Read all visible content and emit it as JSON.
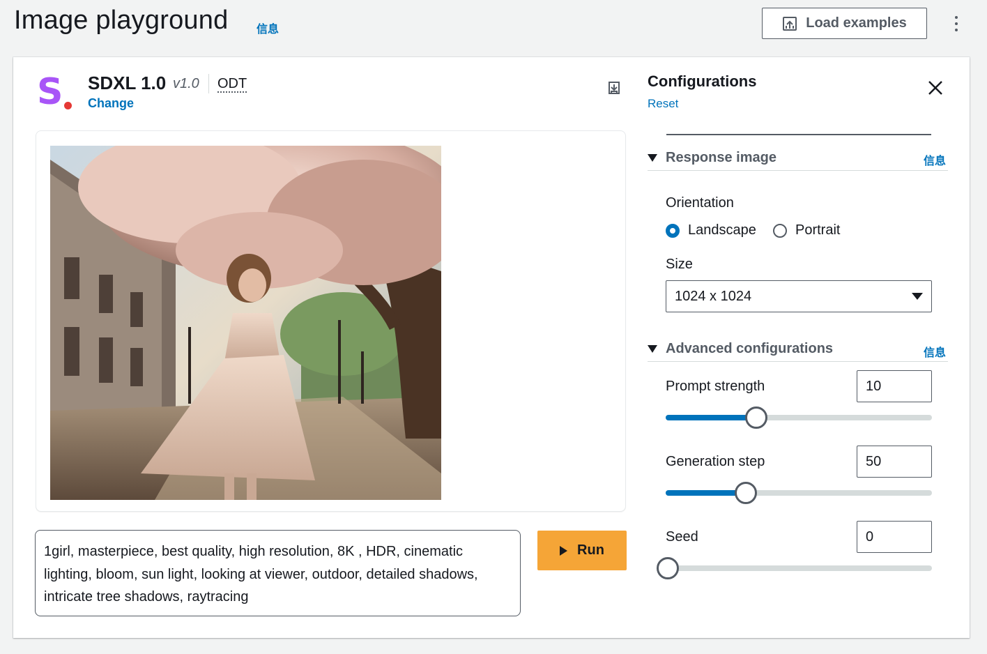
{
  "header": {
    "title": "Image playground",
    "info": "信息",
    "load_examples": "Load examples"
  },
  "model": {
    "name": "SDXL 1.0",
    "version": "v1.0",
    "odt": "ODT",
    "change": "Change",
    "logo_letter": "S",
    "logo_color": "#a855f7",
    "logo_dot_color": "#e53935"
  },
  "prompt": {
    "text": "1girl, masterpiece, best quality, high resolution, 8K , HDR, cinematic lighting, bloom, sun light, looking at viewer, outdoor, detailed shadows, intricate tree shadows, raytracing"
  },
  "run_label": "Run",
  "config": {
    "title": "Configurations",
    "reset": "Reset",
    "response_image": {
      "title": "Response image",
      "info": "信息",
      "orientation_label": "Orientation",
      "options": [
        "Landscape",
        "Portrait"
      ],
      "selected": "Landscape",
      "size_label": "Size",
      "size_value": "1024 x 1024"
    },
    "advanced": {
      "title": "Advanced configurations",
      "info": "信息",
      "prompt_strength": {
        "label": "Prompt strength",
        "value": "10",
        "slider_fraction": 0.34
      },
      "generation_step": {
        "label": "Generation step",
        "value": "50",
        "slider_fraction": 0.3
      },
      "seed": {
        "label": "Seed",
        "value": "0",
        "slider_fraction": 0.0
      }
    }
  },
  "colors": {
    "accent": "#0073bb",
    "run_button": "#f5a537",
    "text": "#16191f"
  }
}
